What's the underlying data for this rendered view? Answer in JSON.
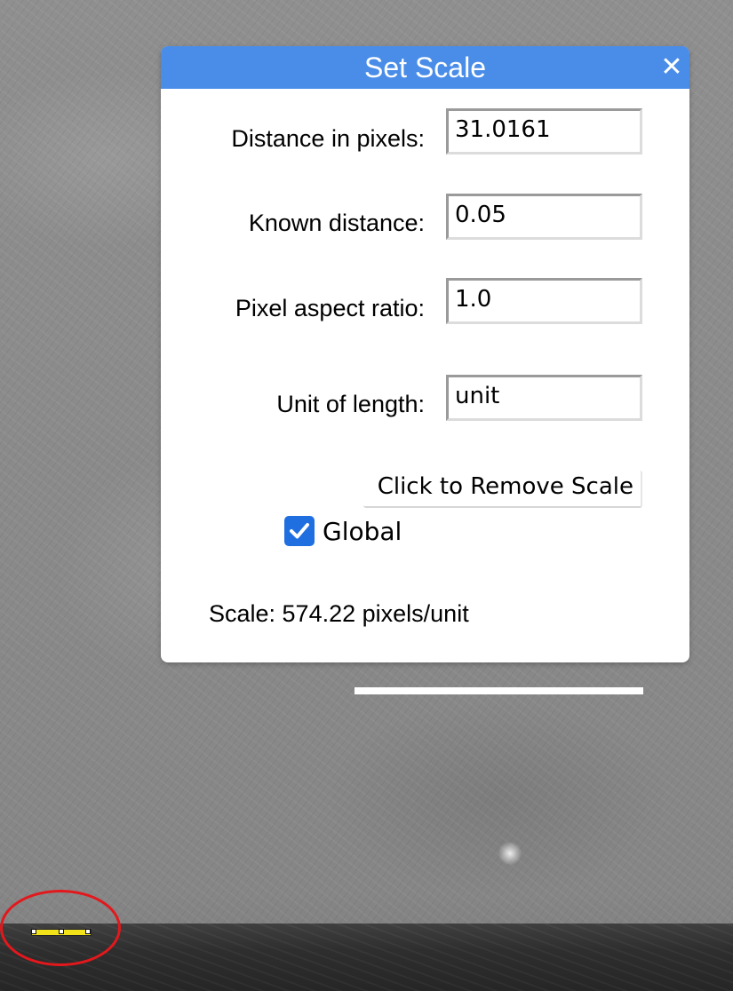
{
  "dialog": {
    "title": "Set Scale",
    "close_icon": "close-icon",
    "fields": [
      {
        "label": "Distance in pixels:",
        "value": "31.0161"
      },
      {
        "label": "Known distance:",
        "value": "0.05"
      },
      {
        "label": "Pixel aspect ratio:",
        "value": "1.0"
      },
      {
        "label": "Unit of length:",
        "value": "unit"
      }
    ],
    "remove_button_label": "Click to Remove Scale",
    "global_checkbox": {
      "label": "Global",
      "checked": true
    },
    "scale_readout": "Scale: 574.22 pixels/unit"
  },
  "colors": {
    "header": "#4a8de8",
    "checkbox": "#1f6fe0",
    "measure_line": "#f2e21a",
    "circle_marker": "#e3181c",
    "scale_bar": "#ffffff"
  }
}
